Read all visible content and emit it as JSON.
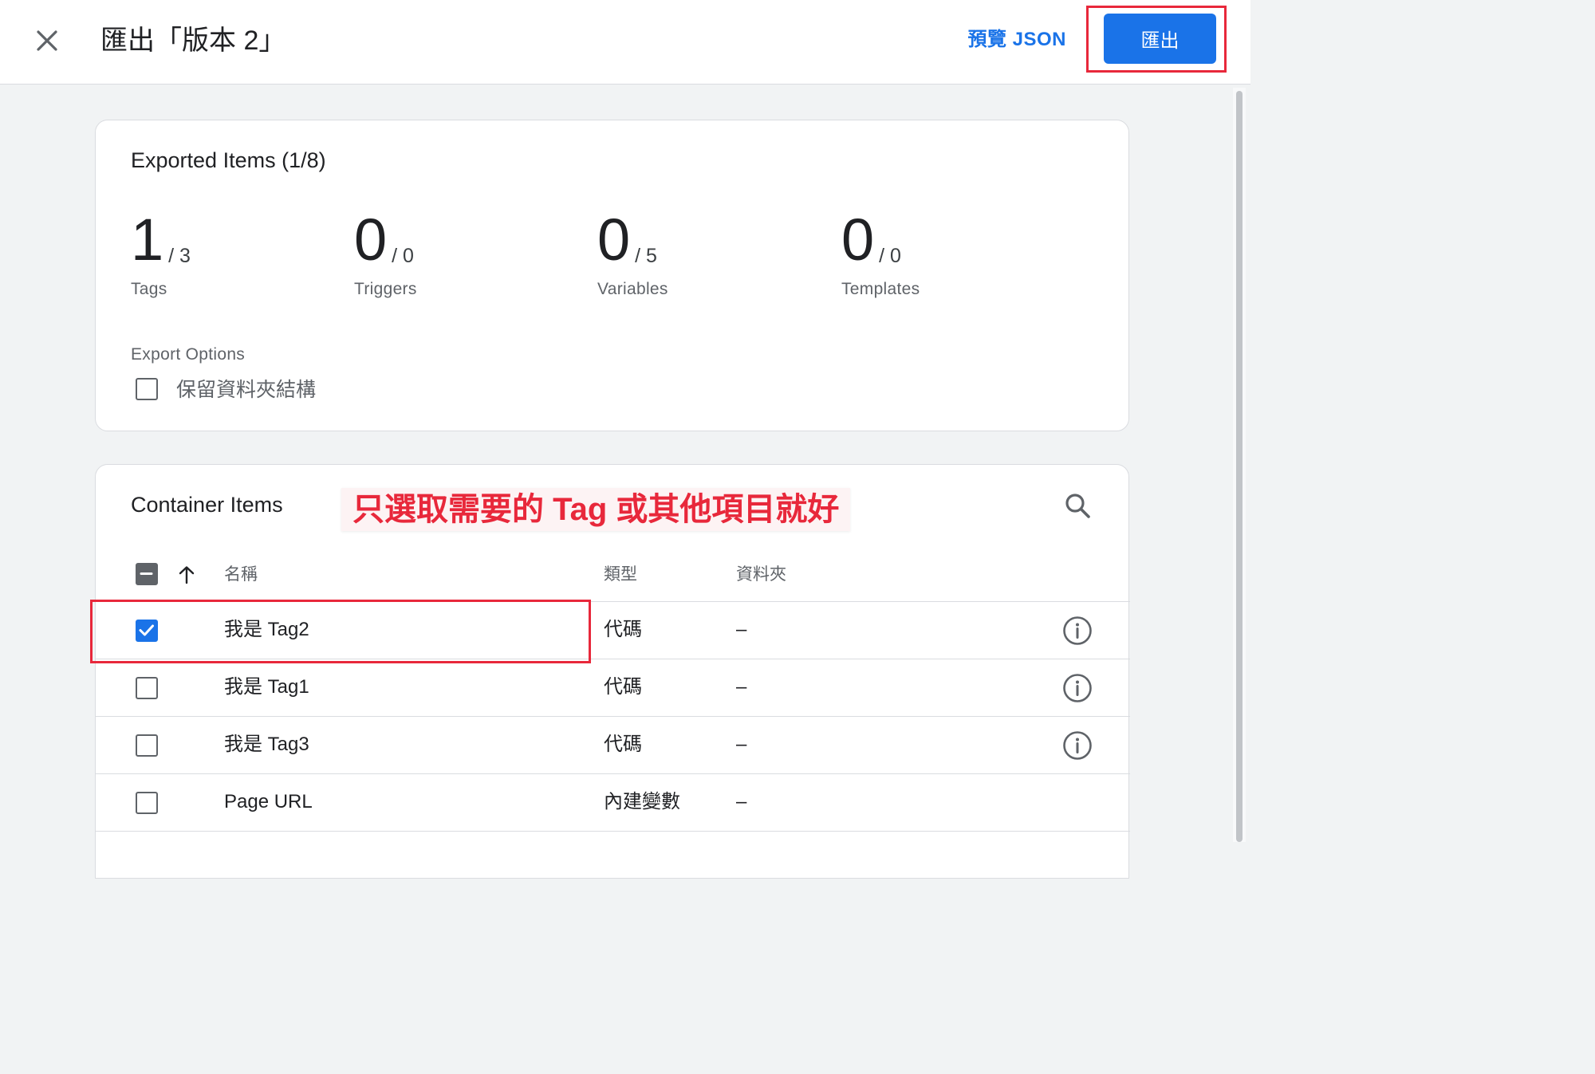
{
  "topbar": {
    "title": "匯出「版本 2」",
    "preview_label": "預覽 JSON",
    "export_label": "匯出",
    "close_icon": "close-icon"
  },
  "exported": {
    "title": "Exported Items (1/8)",
    "stats": [
      {
        "count": "1",
        "total": "/ 3",
        "label": "Tags"
      },
      {
        "count": "0",
        "total": "/ 0",
        "label": "Triggers"
      },
      {
        "count": "0",
        "total": "/ 5",
        "label": "Variables"
      },
      {
        "count": "0",
        "total": "/ 0",
        "label": "Templates"
      }
    ],
    "options_label": "Export Options",
    "option_keep_folders": "保留資料夾結構",
    "option_keep_folders_checked": false
  },
  "container": {
    "title": "Container Items",
    "annotation": "只選取需要的 Tag 或其他項目就好",
    "search_icon": "search-icon",
    "columns": {
      "name": "名稱",
      "type": "類型",
      "folder": "資料夾"
    },
    "rows": [
      {
        "name": "我是 Tag2",
        "type": "代碼",
        "folder": "–",
        "checked": true,
        "has_info": true
      },
      {
        "name": "我是 Tag1",
        "type": "代碼",
        "folder": "–",
        "checked": false,
        "has_info": true
      },
      {
        "name": "我是 Tag3",
        "type": "代碼",
        "folder": "–",
        "checked": false,
        "has_info": true
      },
      {
        "name": "Page URL",
        "type": "內建變數",
        "folder": "–",
        "checked": false,
        "has_info": false
      }
    ]
  },
  "colors": {
    "accent": "#1a73e8",
    "annotation_red": "#e8283b",
    "background": "#f1f3f4"
  }
}
